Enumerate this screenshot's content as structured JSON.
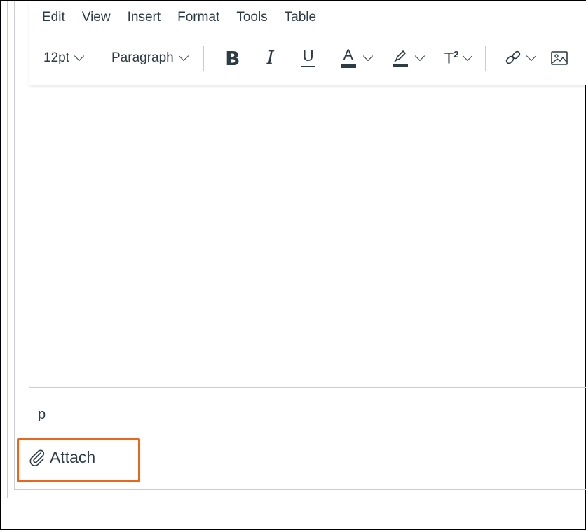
{
  "menubar": {
    "items": [
      {
        "label": "Edit"
      },
      {
        "label": "View"
      },
      {
        "label": "Insert"
      },
      {
        "label": "Format"
      },
      {
        "label": "Tools"
      },
      {
        "label": "Table"
      }
    ]
  },
  "toolbar": {
    "font_size": "12pt",
    "block_format": "Paragraph",
    "bold_label": "B",
    "italic_label": "I",
    "underline_label": "U",
    "text_color_label": "A",
    "superscript_label": "T",
    "superscript_mark": "2",
    "icons": {
      "text_color_bar": "#2d3b45",
      "highlight_bar": "#2d3b45"
    }
  },
  "editor": {
    "content": ""
  },
  "status": {
    "path": "p"
  },
  "attach": {
    "label": "Attach",
    "highlight_color": "#e8671a"
  }
}
